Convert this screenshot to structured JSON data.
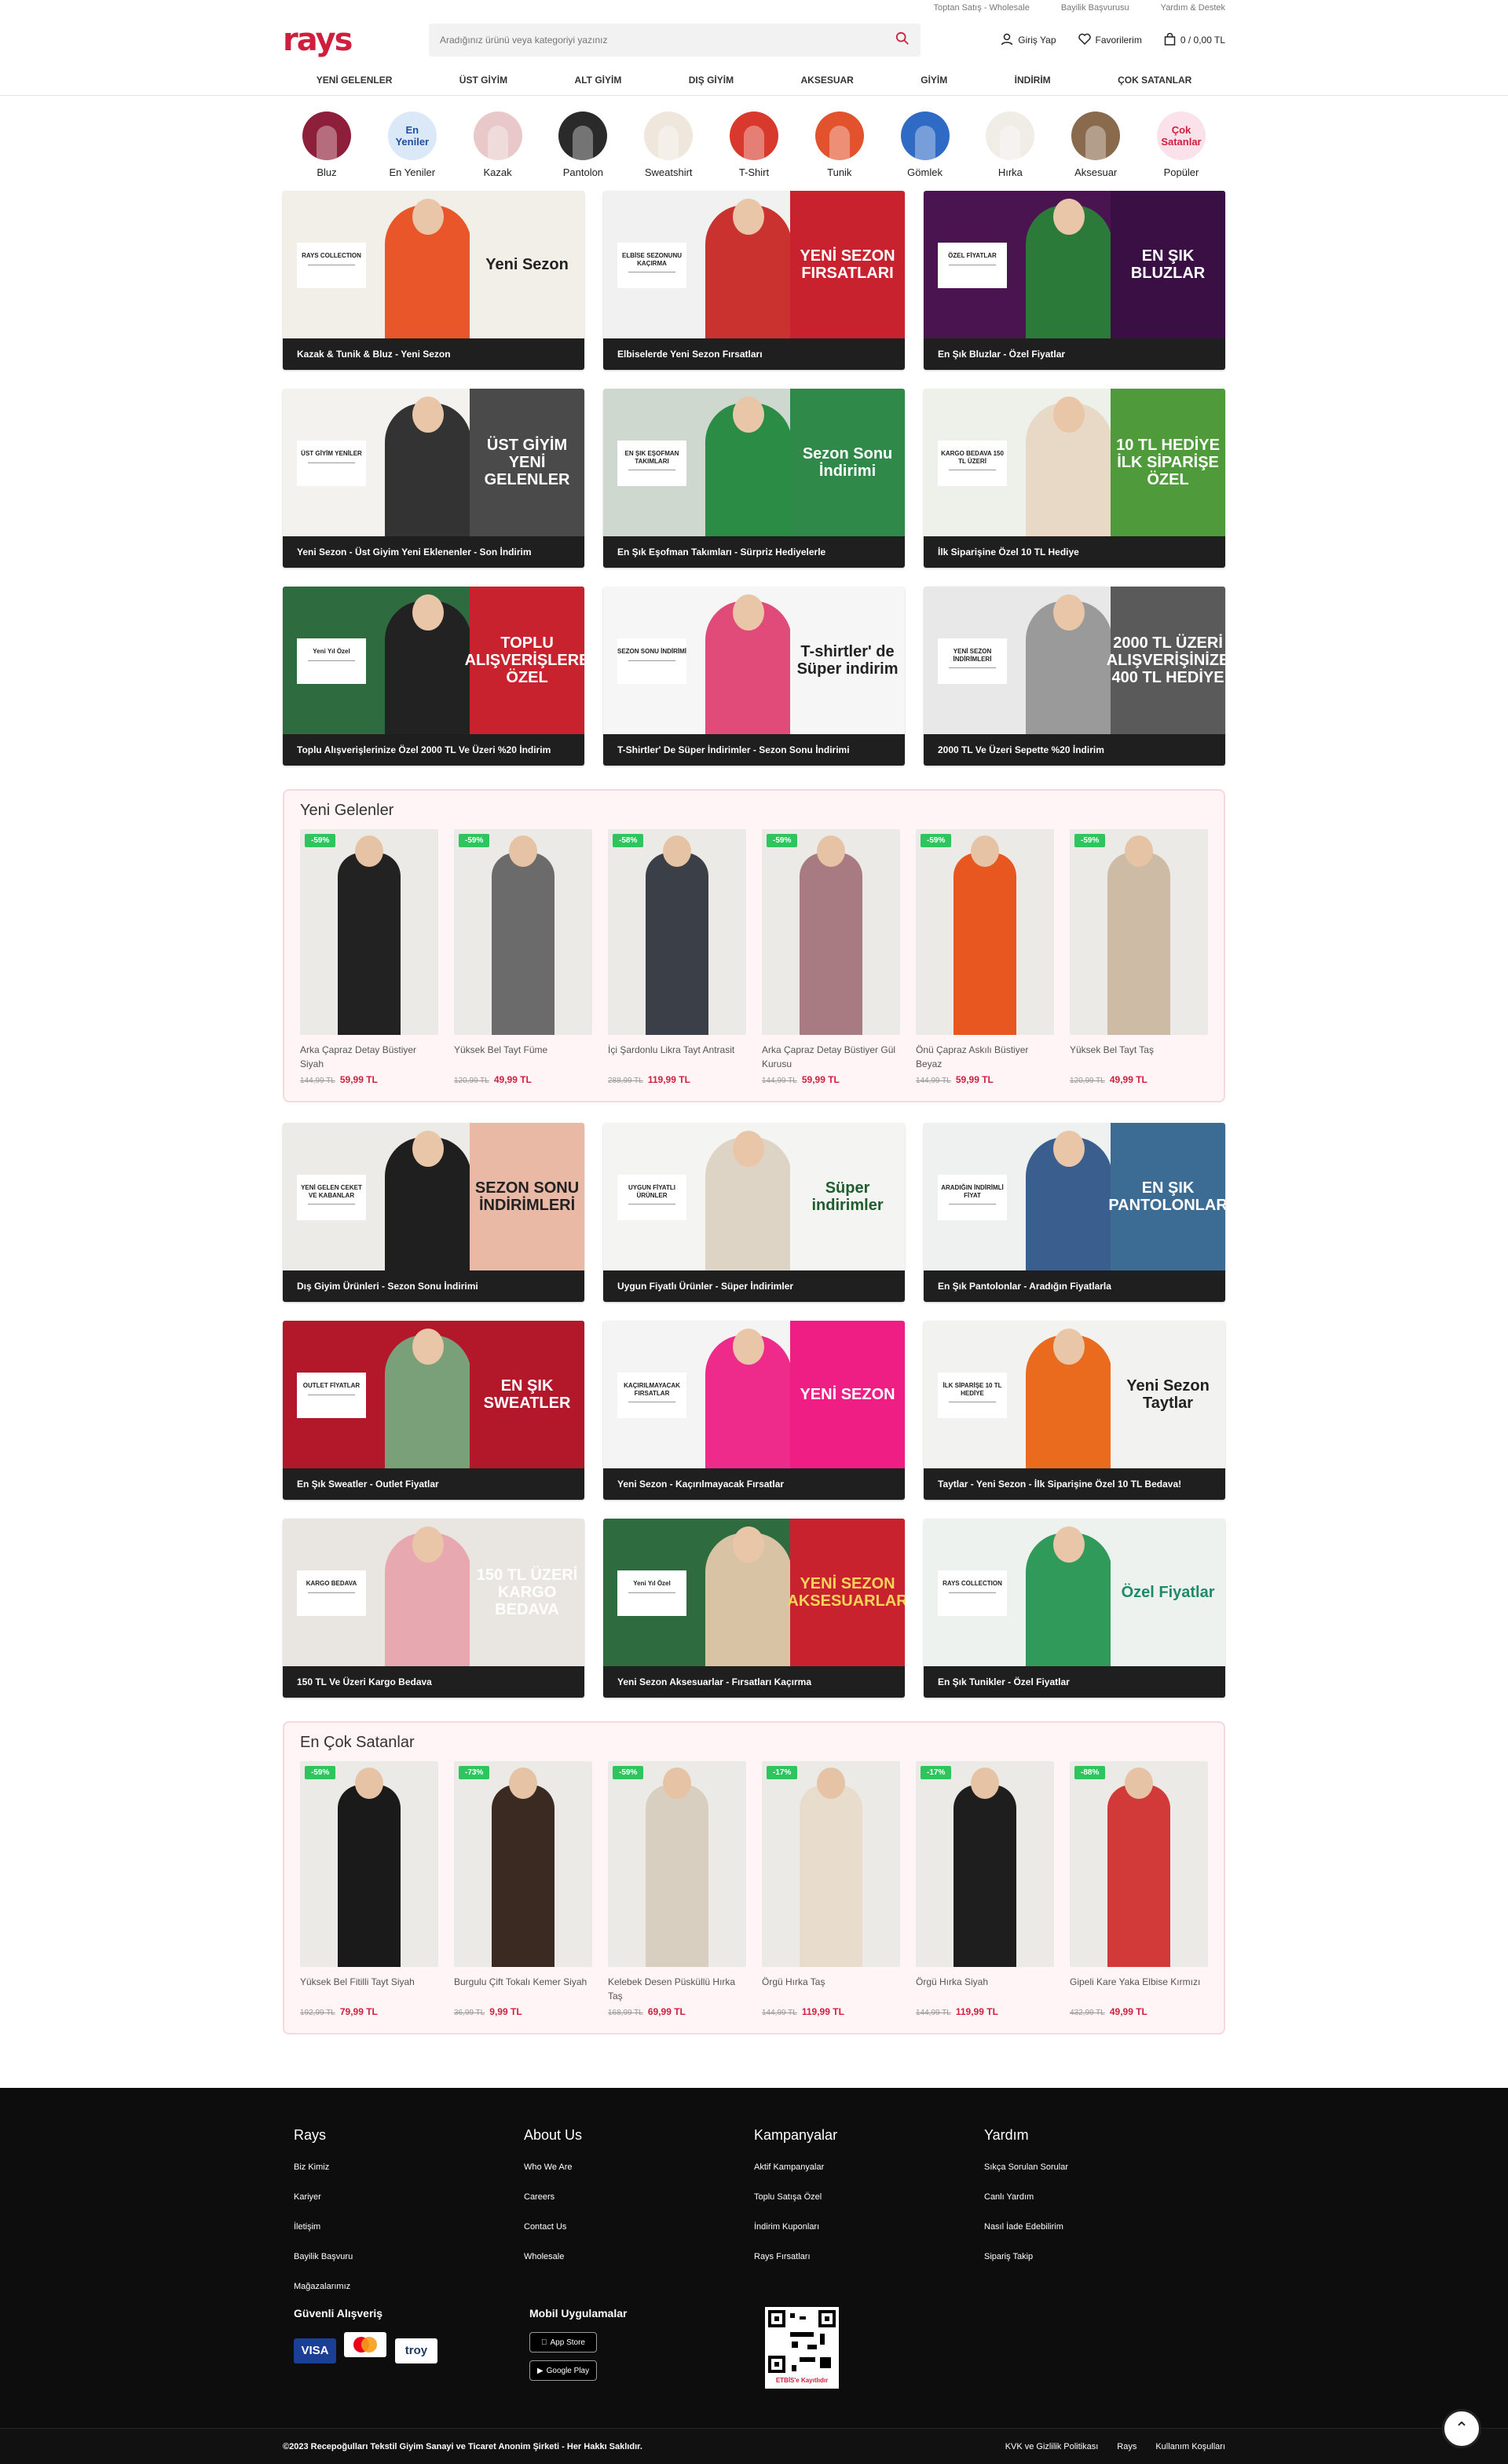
{
  "topbar": [
    "Toptan Satış - Wholesale",
    "Bayilik Başvurusu",
    "Yardım & Destek"
  ],
  "header": {
    "logo": "rays",
    "search_placeholder": "Aradığınız ürünü veya kategoriyi yazınız",
    "login": "Giriş Yap",
    "favorites": "Favorilerim",
    "cart": "0 / 0,00 TL"
  },
  "nav": [
    "YENİ GELENLER",
    "ÜST GİYİM",
    "ALT GİYİM",
    "DIŞ GİYİM",
    "AKSESUAR",
    "GİYİM",
    "İNDİRİM",
    "ÇOK SATANLAR"
  ],
  "categories": [
    {
      "label": "Bluz",
      "color": "#8e1f3a"
    },
    {
      "label": "En Yeniler",
      "color": "#dbe8f7",
      "text": "En\nYeniler"
    },
    {
      "label": "Kazak",
      "color": "#e8c8c8"
    },
    {
      "label": "Pantolon",
      "color": "#2a2a2a"
    },
    {
      "label": "Sweatshirt",
      "color": "#efe6dc"
    },
    {
      "label": "T-Shirt",
      "color": "#d8392c"
    },
    {
      "label": "Tunik",
      "color": "#e2532d"
    },
    {
      "label": "Gömlek",
      "color": "#2f6bc4"
    },
    {
      "label": "Hırka",
      "color": "#f0ece6"
    },
    {
      "label": "Aksesuar",
      "color": "#8a6a4d"
    },
    {
      "label": "Popüler",
      "color": "#fbe2ea",
      "text": "Çok\nSatanlar"
    }
  ],
  "banners1": [
    {
      "caption": "Kazak & Tunik & Bluz - Yeni Sezon",
      "tag": "RAYS COLLECTION",
      "panel": "Yeni Sezon",
      "bg": "#f2eee8",
      "panel_bg": "#f2eee8",
      "panel_color": "#222",
      "person": "#e8562a"
    },
    {
      "caption": "Elbiselerde Yeni Sezon Fırsatları",
      "tag": "ELBİSE SEZONUNU KAÇIRMA",
      "panel": "YENİ SEZON FIRSATLARI",
      "bg": "#f1f1f1",
      "panel_bg": "#c9222f",
      "panel_color": "#fff",
      "person": "#c9322e"
    },
    {
      "caption": "En Şık Bluzlar - Özel Fiyatlar",
      "tag": "ÖZEL FİYATLAR",
      "panel": "EN ŞIK BLUZLAR",
      "bg": "#4a1450",
      "panel_bg": "#3a0f44",
      "panel_color": "#fff",
      "person": "#2b7a3a"
    },
    {
      "caption": "Yeni Sezon - Üst Giyim Yeni Eklenenler - Son İndirim",
      "tag": "ÜST GİYİM YENİLER",
      "panel": "ÜST GİYİM YENİ GELENLER",
      "bg": "#f4f2ee",
      "panel_bg": "#4a4a4a",
      "panel_color": "#fff",
      "person": "#333"
    },
    {
      "caption": "En Şık Eşofman Takımları - Sürpriz Hediyelerle",
      "tag": "EN ŞIK EŞOFMAN TAKIMLARI",
      "panel": "Sezon Sonu İndirimi",
      "bg": "#cfd8cf",
      "panel_bg": "#2f8a4a",
      "panel_color": "#fff",
      "person": "#2a8c45"
    },
    {
      "caption": "İlk Siparişine Özel 10 TL Hediye",
      "tag": "KARGO BEDAVA 150 TL ÜZERİ",
      "panel": "10 TL HEDİYE İLK SİPARİŞE ÖZEL",
      "bg": "#eef0ea",
      "panel_bg": "#4f9a3a",
      "panel_color": "#fff",
      "person": "#e8d8c6"
    },
    {
      "caption": "Toplu Alışverişlerinize Özel 2000 TL Ve Üzeri %20 İndirim",
      "tag": "Yeni Yıl Özel",
      "panel": "TOPLU ALIŞVERİŞLERE ÖZEL",
      "bg": "#2e6b3f",
      "panel_bg": "#c9222f",
      "panel_color": "#fff",
      "person": "#222"
    },
    {
      "caption": "T-Shirtler' De Süper İndirimler - Sezon Sonu İndirimi",
      "tag": "SEZON SONU İNDİRİMİ",
      "panel": "T-shirtler' de Süper indirim",
      "bg": "#f6f6f6",
      "panel_bg": "#f6f6f6",
      "panel_color": "#222",
      "person": "#e04b7a"
    },
    {
      "caption": "2000 TL Ve Üzeri Sepette %20 İndirim",
      "tag": "YENİ SEZON İNDİRİMLERİ",
      "panel": "2000 TL ÜZERİ ALIŞVERİŞİNİZE 400 TL HEDİYE",
      "bg": "#e8e8e8",
      "panel_bg": "#5a5a5a",
      "panel_color": "#fff",
      "person": "#9a9a9a"
    }
  ],
  "new_arrivals": {
    "title": "Yeni Gelenler",
    "items": [
      {
        "name": "Arka Çapraz Detay Büstiyer Siyah",
        "discount": "-59%",
        "old": "144,99 TL",
        "price": "59,99 TL",
        "color": "#222"
      },
      {
        "name": "Yüksek Bel Tayt Füme",
        "discount": "-59%",
        "old": "120,99 TL",
        "price": "49,99 TL",
        "color": "#6b6b6b"
      },
      {
        "name": "İçi Şardonlu Likra Tayt Antrasit",
        "discount": "-58%",
        "old": "288,99 TL",
        "price": "119,99 TL",
        "color": "#3b3f47"
      },
      {
        "name": "Arka Çapraz Detay Büstiyer Gül Kurusu",
        "discount": "-59%",
        "old": "144,99 TL",
        "price": "59,99 TL",
        "color": "#a87a82"
      },
      {
        "name": "Önü Çapraz Askılı Büstiyer Beyaz",
        "discount": "-59%",
        "old": "144,99 TL",
        "price": "59,99 TL",
        "color": "#e8571f"
      },
      {
        "name": "Yüksek Bel Tayt Taş",
        "discount": "-59%",
        "old": "120,99 TL",
        "price": "49,99 TL",
        "color": "#cdbba5"
      }
    ]
  },
  "banners2": [
    {
      "caption": "Dış Giyim Ürünleri - Sezon Sonu İndirimi",
      "tag": "YENİ GELEN CEKET VE KABANLAR",
      "panel": "SEZON SONU İNDİRİMLERİ",
      "bg": "#ecebe8",
      "panel_bg": "#e9b9a5",
      "panel_color": "#222",
      "person": "#1f1f1f"
    },
    {
      "caption": "Uygun Fiyatlı Ürünler - Süper İndirimler",
      "tag": "UYGUN FİYATLI ÜRÜNLER",
      "panel": "Süper indirimler",
      "bg": "#f4f4f2",
      "panel_bg": "#f4f4f2",
      "panel_color": "#1e5e2e",
      "person": "#ddd4c6"
    },
    {
      "caption": "En Şık Pantolonlar - Aradığın Fiyatlarla",
      "tag": "ARADIĞIN İNDİRİMLİ FİYAT",
      "panel": "EN ŞIK PANTOLONLAR",
      "bg": "#eef1ef",
      "panel_bg": "#3c6b94",
      "panel_color": "#fff",
      "person": "#3a5f8e"
    },
    {
      "caption": "En Şık Sweatler - Outlet Fiyatlar",
      "tag": "OUTLET FİYATLAR",
      "panel": "EN ŞIK SWEATLER",
      "bg": "#b3172a",
      "panel_bg": "#b3172a",
      "panel_color": "#fff",
      "person": "#7aa07a"
    },
    {
      "caption": "Yeni Sezon - Kaçırılmayacak Fırsatlar",
      "tag": "KAÇIRILMAYACAK FIRSATLAR",
      "panel": "YENİ SEZON",
      "bg": "#f4f4f4",
      "panel_bg": "#ee1e84",
      "panel_color": "#fff",
      "person": "#ee2a8a"
    },
    {
      "caption": "Taytlar - Yeni Sezon - İlk Siparişine Özel 10 TL Bedava!",
      "tag": "İLK SİPARİŞE 10 TL HEDİYE",
      "panel": "Yeni Sezon Taytlar",
      "bg": "#f2f2f0",
      "panel_bg": "#f2f2f0",
      "panel_color": "#222",
      "person": "#ea6a1e"
    },
    {
      "caption": "150 TL Ve Üzeri Kargo Bedava",
      "tag": "KARGO BEDAVA",
      "panel": "150 TL ÜZERİ KARGO BEDAVA",
      "bg": "#e9e6e2",
      "panel_bg": "#e9e6e2",
      "panel_color": "#fff",
      "person": "#e8a8b0"
    },
    {
      "caption": "Yeni Sezon Aksesuarlar - Fırsatları Kaçırma",
      "tag": "Yeni Yıl Özel",
      "panel": "YENİ SEZON AKSESUARLAR",
      "bg": "#2e6b3f",
      "panel_bg": "#c9222f",
      "panel_color": "#f6d35a",
      "person": "#d8c4a4"
    },
    {
      "caption": "En Şık Tunikler - Özel Fiyatlar",
      "tag": "RAYS COLLECTION",
      "panel": "Özel Fiyatlar",
      "bg": "#eef2ee",
      "panel_bg": "#eef2ee",
      "panel_color": "#1f8a6a",
      "person": "#2f9a5a"
    }
  ],
  "best_sellers": {
    "title": "En Çok Satanlar",
    "items": [
      {
        "name": "Yüksek Bel Fitilli Tayt Siyah",
        "discount": "-59%",
        "old": "192,99 TL",
        "price": "79,99 TL",
        "color": "#1a1a1a"
      },
      {
        "name": "Burgulu Çift Tokalı Kemer Siyah",
        "discount": "-73%",
        "old": "36,99 TL",
        "price": "9,99 TL",
        "color": "#3a2a22"
      },
      {
        "name": "Kelebek Desen Püsküllü Hırka Taş",
        "discount": "-59%",
        "old": "168,99 TL",
        "price": "69,99 TL",
        "color": "#d9cfc0"
      },
      {
        "name": "Örgü Hırka Taş",
        "discount": "-17%",
        "old": "144,99 TL",
        "price": "119,99 TL",
        "color": "#e8ddcc"
      },
      {
        "name": "Örgü Hırka Siyah",
        "discount": "-17%",
        "old": "144,99 TL",
        "price": "119,99 TL",
        "color": "#1e1e1e"
      },
      {
        "name": "Gipeli Kare Yaka Elbise Kırmızı",
        "discount": "-88%",
        "old": "432,99 TL",
        "price": "49,99 TL",
        "color": "#d23a3a"
      }
    ]
  },
  "footer": {
    "cols": [
      {
        "title": "Rays",
        "links": [
          "Biz Kimiz",
          "Kariyer",
          "İletişim",
          "Bayilik Başvuru",
          "Mağazalarımız"
        ]
      },
      {
        "title": "About Us",
        "links": [
          "Who We Are",
          "Careers",
          "Contact Us",
          "Wholesale"
        ]
      },
      {
        "title": "Kampanyalar",
        "links": [
          "Aktif Kampanyalar",
          "Toplu Satışa Özel",
          "İndirim Kuponları",
          "Rays Fırsatları"
        ]
      },
      {
        "title": "Yardım",
        "links": [
          "Sıkça Sorulan Sorular",
          "Canlı Yardım",
          "Nasıl İade Edebilirim",
          "Sipariş Takip"
        ]
      }
    ],
    "secure": "Güvenli Alışveriş",
    "cards": [
      "VISA",
      "MC",
      "troy"
    ],
    "mobile": "Mobil Uygulamalar",
    "stores": [
      "App Store",
      "Google Play"
    ],
    "etbis": "ETBİS'e Kayıtlıdır",
    "copyright": "©2023 Recepoğulları Tekstil Giyim Sanayi ve Ticaret Anonim Şirketi - Her Hakkı Saklıdır.",
    "bottom_links": [
      "KVK ve Gizlilik Politikası",
      "Rays",
      "Kullanım Koşulları"
    ]
  }
}
